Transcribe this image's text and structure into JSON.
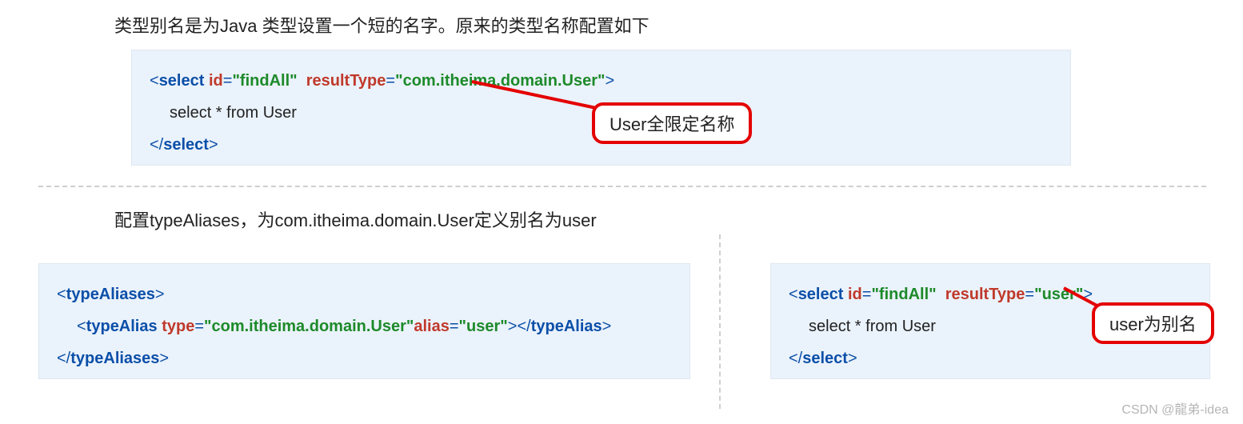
{
  "headings": {
    "h1": "类型别名是为Java 类型设置一个短的名字。原来的类型名称配置如下",
    "h2": "配置typeAliases，为com.itheima.domain.User定义别名为user"
  },
  "code1": {
    "open_lt": "<",
    "tag_open": "select",
    "attr1": "id",
    "val1": "\"findAll\"",
    "attr2": "resultType",
    "val2": "\"com.itheima.domain.User\"",
    "gt": ">",
    "body": "select * from User",
    "close_lt": "</",
    "tag_close": "select",
    "close_gt": ">"
  },
  "code2": {
    "outer_open_lt": "<",
    "outer_tag": "typeAliases",
    "gt": ">",
    "inner_open_lt": "<",
    "inner_tag": "typeAlias",
    "attr1": "type",
    "val1": "\"com.itheima.domain.User\"",
    "attr2": "alias",
    "val2": "\"user\"",
    "inner_gt": ">",
    "inner_close_lt": "</",
    "inner_close_gt": ">",
    "outer_close_lt": "</",
    "outer_close_gt": ">"
  },
  "code3": {
    "open_lt": "<",
    "tag_open": "select",
    "attr1": "id",
    "val1": "\"findAll\"",
    "attr2": "resultType",
    "val2": "\"user\"",
    "gt": ">",
    "body": "select * from User",
    "close_lt": "</",
    "tag_close": "select",
    "close_gt": ">"
  },
  "callouts": {
    "c1": "User全限定名称",
    "c2": "user为别名"
  },
  "watermark": "CSDN @龍弟-idea"
}
